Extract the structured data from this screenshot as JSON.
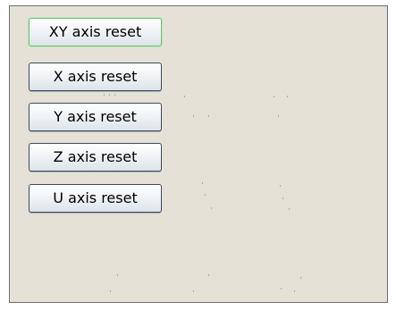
{
  "axis_reset_panel": {
    "buttons": [
      {
        "id": "xy",
        "label": "XY axis reset",
        "focused": true
      },
      {
        "id": "x",
        "label": "X axis reset",
        "focused": false
      },
      {
        "id": "y",
        "label": "Y axis reset",
        "focused": false
      },
      {
        "id": "z",
        "label": "Z axis reset",
        "focused": false
      },
      {
        "id": "u",
        "label": "U axis reset",
        "focused": false
      }
    ],
    "colors": {
      "panel_background": "#e5e1d6",
      "panel_border": "#6e6e6e",
      "button_border": "#3d4a5a",
      "focus_border": "#6cc36c"
    }
  }
}
